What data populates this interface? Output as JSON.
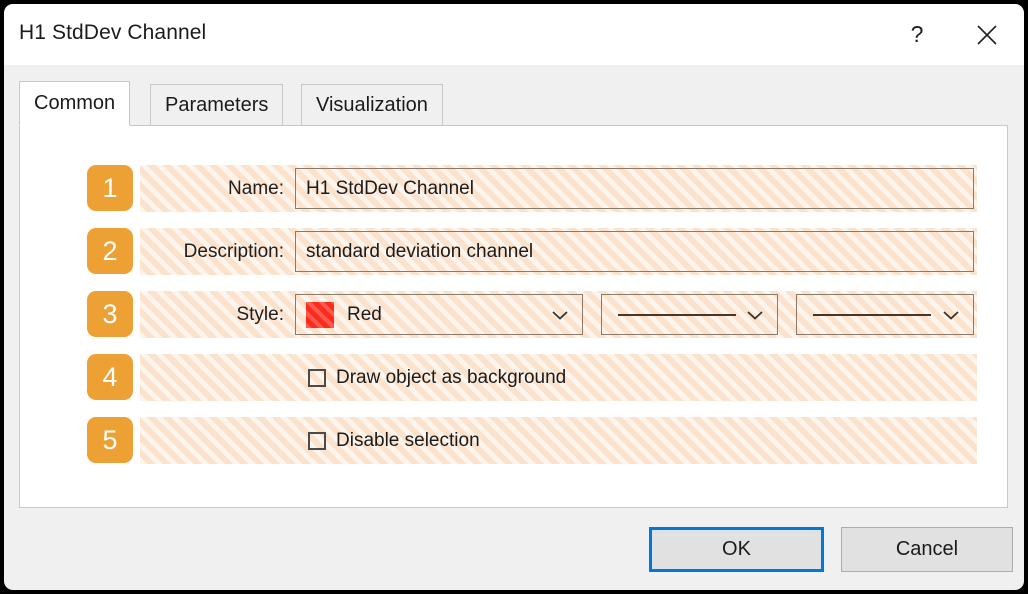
{
  "window": {
    "title": "H1 StdDev Channel",
    "help_icon": "question-mark-icon",
    "help_label": "?",
    "close_icon": "close-icon"
  },
  "tabs": [
    {
      "label": "Common",
      "active": true
    },
    {
      "label": "Parameters",
      "active": false
    },
    {
      "label": "Visualization",
      "active": false
    }
  ],
  "form": {
    "rows": [
      {
        "badge": "1",
        "label": "Name:",
        "value": "H1 StdDev Channel"
      },
      {
        "badge": "2",
        "label": "Description:",
        "value": "standard deviation channel"
      },
      {
        "badge": "3",
        "label": "Style:",
        "color_name": "Red",
        "color_hex": "#fb2b1d",
        "line_width_style": "solid",
        "line_style": "solid"
      },
      {
        "badge": "4",
        "label": "Draw object as background",
        "checked": false
      },
      {
        "badge": "5",
        "label": "Disable selection",
        "checked": false
      }
    ]
  },
  "footer": {
    "ok_label": "OK",
    "cancel_label": "Cancel"
  },
  "colors": {
    "badge_orange": "#eda033",
    "row_hatch_base": "#fbe2cd",
    "focus_blue": "#0078d7",
    "swatch_red": "#fb2b1d"
  }
}
